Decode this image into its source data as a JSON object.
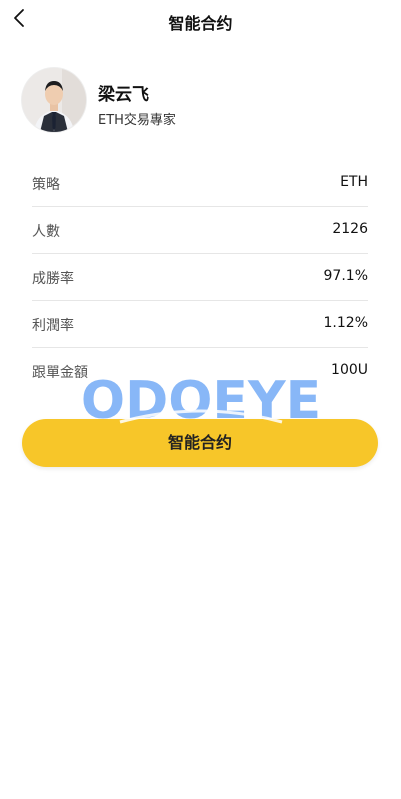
{
  "header": {
    "title": "智能合约",
    "back_icon": "chevron-left-icon"
  },
  "profile": {
    "name": "梁云飞",
    "subtitle": "ETH交易專家"
  },
  "stats": [
    {
      "label": "策略",
      "value": "ETH"
    },
    {
      "label": "人數",
      "value": "2126"
    },
    {
      "label": "成勝率",
      "value": "97.1%"
    },
    {
      "label": "利潤率",
      "value": "1.12%"
    },
    {
      "label": "跟單金額",
      "value": "100U"
    }
  ],
  "watermark": {
    "text": "ODOEYE",
    "color": "#5b9cf4"
  },
  "cta": {
    "label": "智能合约",
    "color": "#f7c629"
  }
}
